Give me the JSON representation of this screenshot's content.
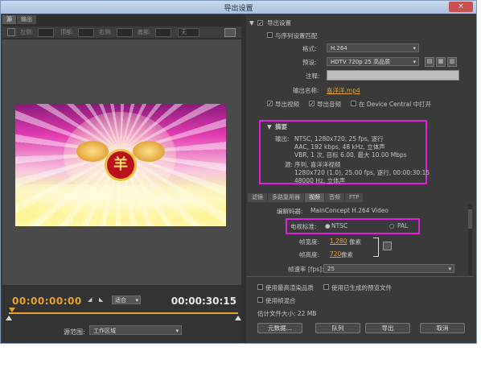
{
  "window": {
    "title": "导出设置",
    "close": "×"
  },
  "left": {
    "tabs": [
      "源",
      "输出"
    ],
    "crop": {
      "left": "左侧:",
      "top": "顶部:",
      "right": "右侧:",
      "bottom": "底部:",
      "ratio": "无"
    },
    "timecode_current": "00:00:00:00",
    "timecode_end": "00:00:30:15",
    "fit": "适合",
    "emblem_char": "羊",
    "source_range_label": "源范围:",
    "source_range_value": "工作区域"
  },
  "right": {
    "export_settings_title": "导出设置",
    "match_sequence": "与序列设置匹配",
    "format_label": "格式:",
    "format_value": "H.264",
    "preset_label": "预设:",
    "preset_value": "HDTV 720p 25 高品质",
    "comment_label": "注释:",
    "output_name_label": "输出名称:",
    "output_name_value": "喜洋洋.mp4",
    "export_video": "导出视频",
    "export_audio": "导出音频",
    "device_central": "在 Device Central 中打开",
    "summary_title": "摘要",
    "summary_output_label": "输出:",
    "summary_output_lines": [
      "NTSC, 1280x720, 25 fps, 逐行",
      "AAC, 192 kbps, 48 kHz, 立体声",
      "VBR, 1 次, 目标 6.00, 最大 10.00 Mbps"
    ],
    "summary_source_label": "源:",
    "summary_source_lines": [
      "序列, 喜洋洋视频",
      "1280x720 (1.0), 25.00 fps, 逐行, 00:00:30:15",
      "48000 Hz, 立体声"
    ],
    "lower_tabs": [
      "滤镜",
      "多路复用器",
      "视频",
      "音频",
      "FTP"
    ],
    "codec_label": "编解码器:",
    "codec_value": "MainConcept H.264 Video",
    "tv_standard_label": "电视标准:",
    "ntsc": "NTSC",
    "pal": "PAL",
    "frame_width_label": "帧宽度:",
    "frame_width_value": "1,280",
    "frame_height_label": "帧高度:",
    "frame_height_value": "720",
    "pixels": "像素",
    "frame_rate_label": "帧速率 [fps]:",
    "frame_rate_value": "25",
    "max_render": "使用最高渲染品质",
    "use_previews": "使用已生成的预览文件",
    "use_blend": "使用帧混合",
    "file_size": "估计文件大小: 22 MB",
    "btn_metadata": "元数据...",
    "btn_queue": "队列",
    "btn_export": "导出",
    "btn_cancel": "取消"
  },
  "colors": {
    "accent": "#e9a22a",
    "highlight": "#e020e0"
  }
}
